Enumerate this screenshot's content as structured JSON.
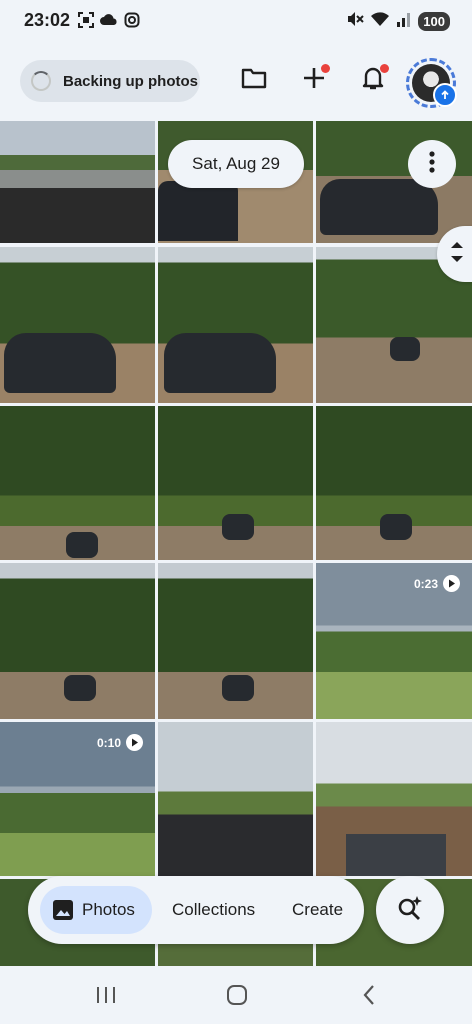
{
  "status_bar": {
    "time": "23:02",
    "battery": "100"
  },
  "header": {
    "backup_label": "Backing up photos"
  },
  "grid": {
    "date_label": "Sat, Aug 29",
    "video_durations": [
      "0:23",
      "0:10"
    ]
  },
  "bottom_nav": {
    "tabs": [
      {
        "label": "Photos",
        "active": true
      },
      {
        "label": "Collections",
        "active": false
      },
      {
        "label": "Create",
        "active": false
      }
    ]
  },
  "colors": {
    "background": "#f0f4f9",
    "accent": "#1a73e8",
    "active_tab_bg": "#d3e3fd",
    "notification_dot": "#e9423d"
  },
  "icons": [
    "screenshot-icon",
    "cloud-icon",
    "instagram-icon",
    "mute-icon",
    "wifi-icon",
    "signal-icon",
    "folder-icon",
    "add-icon",
    "bell-icon",
    "more-vert-icon",
    "play-icon",
    "photos-icon",
    "search-sparkle-icon",
    "recents-icon",
    "home-icon",
    "back-icon"
  ]
}
